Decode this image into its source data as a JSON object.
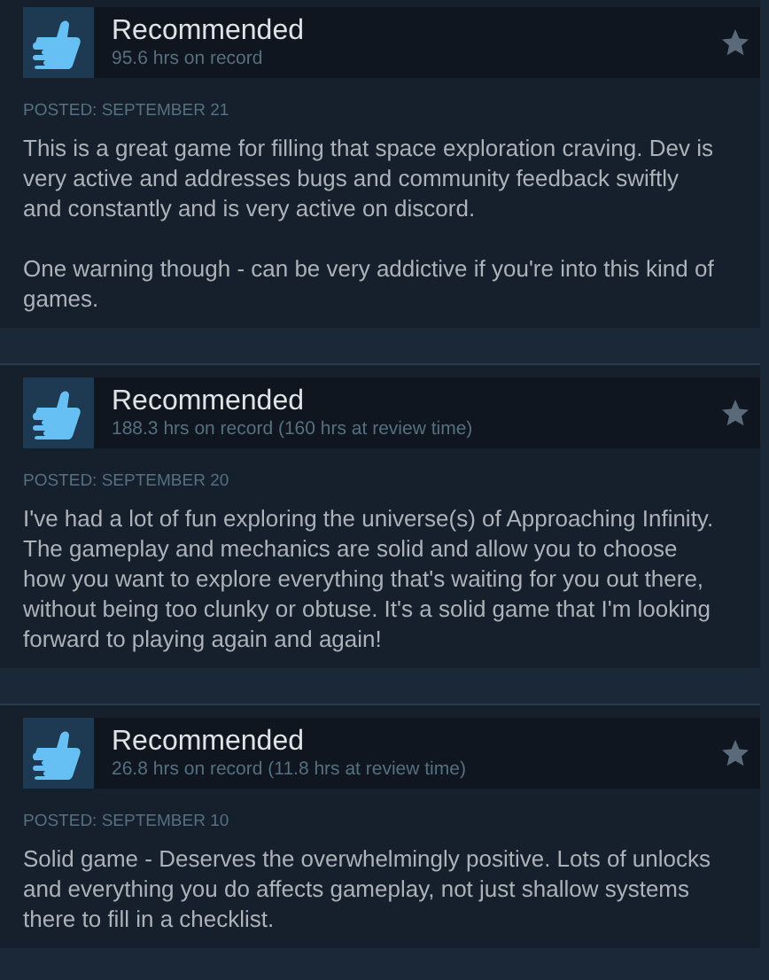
{
  "reviews": [
    {
      "title": "Recommended",
      "hours": "95.6 hrs on record",
      "posted": "POSTED: SEPTEMBER 21",
      "paragraphs": [
        "This is a great game for filling that space exploration craving. Dev is very active and addresses bugs and community feedback swiftly and constantly and is very active on discord.",
        "One warning though - can be very addictive if you're into this kind of games."
      ]
    },
    {
      "title": "Recommended",
      "hours": "188.3 hrs on record (160 hrs at review time)",
      "posted": "POSTED: SEPTEMBER 20",
      "paragraphs": [
        "I've had a lot of fun exploring the universe(s) of Approaching Infinity. The gameplay and mechanics are solid and allow you to choose how you want to explore everything that's waiting for you out there, without being too clunky or obtuse. It's a solid game that I'm looking forward to playing again and again!"
      ]
    },
    {
      "title": "Recommended",
      "hours": "26.8 hrs on record (11.8 hrs at review time)",
      "posted": "POSTED: SEPTEMBER 10",
      "paragraphs": [
        "Solid game - Deserves the overwhelmingly positive. Lots of unlocks and everything you do affects gameplay, not just shallow systems there to fill in a checklist."
      ]
    }
  ]
}
